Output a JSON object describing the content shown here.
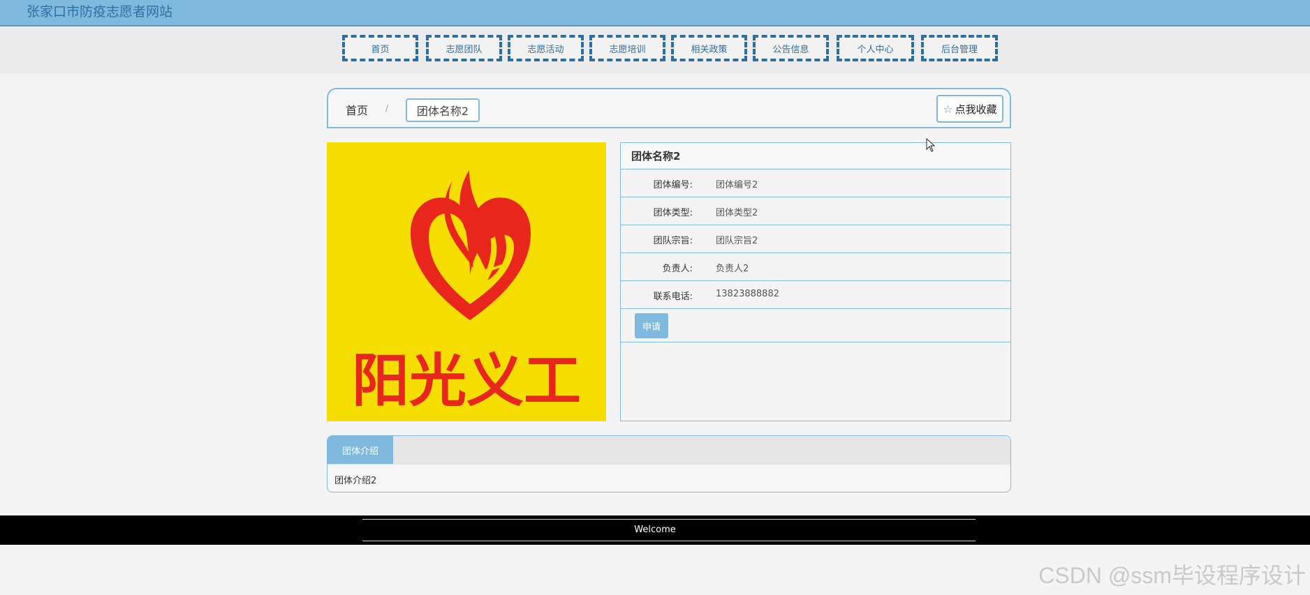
{
  "header": {
    "site_title": "张家口市防疫志愿者网站"
  },
  "nav": {
    "items": [
      {
        "label": "首页"
      },
      {
        "label": "志愿团队"
      },
      {
        "label": "志愿活动"
      },
      {
        "label": "志愿培训"
      },
      {
        "label": "相关政策"
      },
      {
        "label": "公告信息"
      },
      {
        "label": "个人中心"
      },
      {
        "label": "后台管理"
      }
    ]
  },
  "breadcrumb": {
    "home": "首页",
    "separator": "/",
    "current": "团体名称2"
  },
  "favorite": {
    "icon": "star-outline-icon",
    "label": "点我收藏"
  },
  "logo": {
    "text": "阳光义工",
    "background": "#f5dd00",
    "accent": "#e8261b"
  },
  "detail": {
    "title": "团体名称2",
    "fields": [
      {
        "label": "团体编号:",
        "value": "团体编号2"
      },
      {
        "label": "团体类型:",
        "value": "团体类型2"
      },
      {
        "label": "团队宗旨:",
        "value": "团队宗旨2"
      },
      {
        "label": "负责人:",
        "value": "负责人2"
      },
      {
        "label": "联系电话:",
        "value": "13823888882"
      }
    ],
    "apply_label": "申请"
  },
  "intro": {
    "tab_label": "团体介绍",
    "content": "团体介绍2"
  },
  "footer": {
    "text": "Welcome"
  },
  "watermark": {
    "text": "CSDN @ssm毕设程序设计"
  },
  "colors": {
    "primary": "#7fbade",
    "nav_border": "#2f6ea0",
    "footer_bg": "#000000"
  }
}
